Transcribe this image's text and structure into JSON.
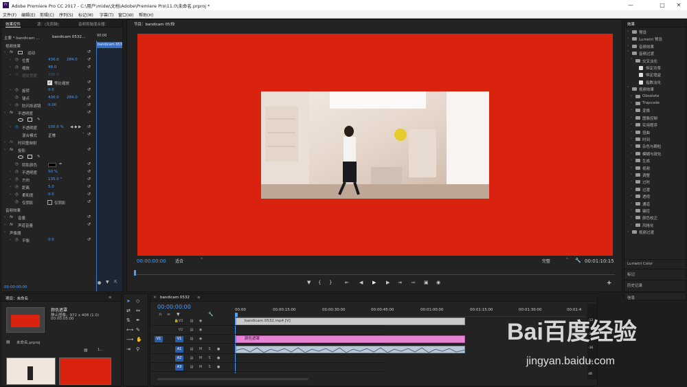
{
  "window": {
    "app_icon": "Pr",
    "title": "Adobe Premiere Pro CC 2017 - C:\\用户\\midw\\文档\\Adobe\\Premiere Pro\\11.0\\未命名.prproj *",
    "controls": [
      "minimize-icon",
      "maximize-icon",
      "close-icon"
    ]
  },
  "menu": [
    "文件(F)",
    "编辑(E)",
    "剪辑(C)",
    "序列(S)",
    "标记(M)",
    "字幕(T)",
    "窗口(W)",
    "帮助(H)"
  ],
  "effect_controls": {
    "tabs": [
      "效果控件",
      "源：(无剪辑)",
      "音频剪辑混合器："
    ],
    "master": "主要 * bandicam ...",
    "clip": "bandicam 0532...",
    "time_start": "00:00",
    "clip_bar": "bandicam 0532",
    "video_effects": "视频效果",
    "motion": "运动",
    "position": {
      "label": "位置",
      "x": "436.0",
      "y": "284.0"
    },
    "scale": {
      "label": "缩放",
      "value": "49.0"
    },
    "scale_width": {
      "label": "缩放宽度",
      "value": "100.0"
    },
    "uniform_scale": "等比缩放",
    "rotation": {
      "label": "旋转",
      "value": "0.0"
    },
    "anchor": {
      "label": "锚点",
      "x": "436.0",
      "y": "284.0"
    },
    "anti_flicker": {
      "label": "防闪烁滤镜",
      "value": "0.00"
    },
    "opacity_group": "不透明度",
    "opacity": {
      "label": "不透明度",
      "value": "100.0 %"
    },
    "blend": {
      "label": "混合模式",
      "value": "正常"
    },
    "time_remap": "时间重映射",
    "shadow": "投影",
    "shadow_color": "阴影颜色",
    "shadow_opacity": {
      "label": "不透明度",
      "value": "50 %"
    },
    "direction": {
      "label": "方向",
      "value": "135.0 °"
    },
    "distance": {
      "label": "距离",
      "value": "5.0"
    },
    "softness": {
      "label": "柔和度",
      "value": "0.0"
    },
    "shadow_only": {
      "label": "仅阴影",
      "value": "仅阴影"
    },
    "audio_effects": "音频效果",
    "volume": "音量",
    "channel_volume": "声道音量",
    "panner": "声像器",
    "balance": {
      "label": "平衡",
      "value": "0.0"
    },
    "timecode": "00:00:00:00"
  },
  "program": {
    "tab": "节目：bandicam 0532",
    "timecode": "00:00:00:00",
    "fit": "适合",
    "quality": "完整",
    "duration": "00:01:10:15",
    "transport": [
      "marker-icon",
      "in-point-icon",
      "out-point-icon",
      "go-to-in-icon",
      "step-back-icon",
      "play-icon",
      "step-forward-icon",
      "go-to-out-icon",
      "insert-icon",
      "overwrite-icon",
      "export-frame-icon",
      "add-button-icon"
    ],
    "bg_color": "#d9230f"
  },
  "effects_panel": {
    "title": "效果",
    "items": [
      {
        "label": "预设",
        "level": 0,
        "open": false
      },
      {
        "label": "Lumetri 预设",
        "level": 0,
        "open": false
      },
      {
        "label": "音频效果",
        "level": 0,
        "open": false
      },
      {
        "label": "音频过渡",
        "level": 0,
        "open": true
      },
      {
        "label": "交叉淡化",
        "level": 1,
        "open": true
      },
      {
        "label": "恒定功率",
        "level": 2,
        "open": false
      },
      {
        "label": "恒定增益",
        "level": 2,
        "open": false
      },
      {
        "label": "指数淡化",
        "level": 2,
        "open": false
      },
      {
        "label": "视频效果",
        "level": 0,
        "open": true
      },
      {
        "label": "Obsolete",
        "level": 1,
        "open": false
      },
      {
        "label": "Trapcode",
        "level": 1,
        "open": false
      },
      {
        "label": "变换",
        "level": 1,
        "open": false
      },
      {
        "label": "图像控制",
        "level": 1,
        "open": false
      },
      {
        "label": "实用程序",
        "level": 1,
        "open": false
      },
      {
        "label": "扭曲",
        "level": 1,
        "open": false
      },
      {
        "label": "时间",
        "level": 1,
        "open": false
      },
      {
        "label": "杂色与颗粒",
        "level": 1,
        "open": false
      },
      {
        "label": "模糊与锐化",
        "level": 1,
        "open": false
      },
      {
        "label": "生成",
        "level": 1,
        "open": false
      },
      {
        "label": "视频",
        "level": 1,
        "open": false
      },
      {
        "label": "调整",
        "level": 1,
        "open": false
      },
      {
        "label": "过时",
        "level": 1,
        "open": false
      },
      {
        "label": "过渡",
        "level": 1,
        "open": false
      },
      {
        "label": "透视",
        "level": 1,
        "open": false
      },
      {
        "label": "通道",
        "level": 1,
        "open": false
      },
      {
        "label": "键控",
        "level": 1,
        "open": false
      },
      {
        "label": "颜色校正",
        "level": 1,
        "open": false
      },
      {
        "label": "风格化",
        "level": 1,
        "open": false
      },
      {
        "label": "视频过渡",
        "level": 0,
        "open": false
      }
    ],
    "sections": [
      "Lumetri Color",
      "标记",
      "历史记录",
      "信息"
    ]
  },
  "project": {
    "tab": "项目：未命名",
    "item_name": "颜色遮罩",
    "item_type": "静止图像，972 x 408 (1.0)",
    "item_duration": "00:00:05:00",
    "file": "未命名.prproj",
    "counter": "1..."
  },
  "timeline": {
    "tab": "bandicam 0532",
    "timecode": "00:00:00:00",
    "ruler": [
      "00:00",
      "00:00:15:00",
      "00:00:30:00",
      "00:00:45:00",
      "00:01:00:00",
      "00:01:15:00",
      "00:01:30:00",
      "00:01:4"
    ],
    "tracks": [
      {
        "name": "V3",
        "type": "video",
        "source": ""
      },
      {
        "name": "V2",
        "type": "video",
        "source": ""
      },
      {
        "name": "V1",
        "type": "video",
        "source": "V1"
      },
      {
        "name": "A1",
        "type": "audio",
        "source": ""
      },
      {
        "name": "A2",
        "type": "audio",
        "source": ""
      },
      {
        "name": "A3",
        "type": "audio",
        "source": ""
      }
    ],
    "clips": [
      {
        "label": "bandicam 0532.mp4 [V]",
        "track": "V3"
      },
      {
        "label": "颜色遮罩",
        "track": "V1"
      },
      {
        "label": "",
        "track": "A1"
      }
    ],
    "meter_scale": [
      "-12",
      "-24",
      "-36",
      "-48",
      "dB"
    ]
  },
  "watermark": {
    "brand": "Bai百度经验",
    "url": "jingyan.baidu.com"
  }
}
